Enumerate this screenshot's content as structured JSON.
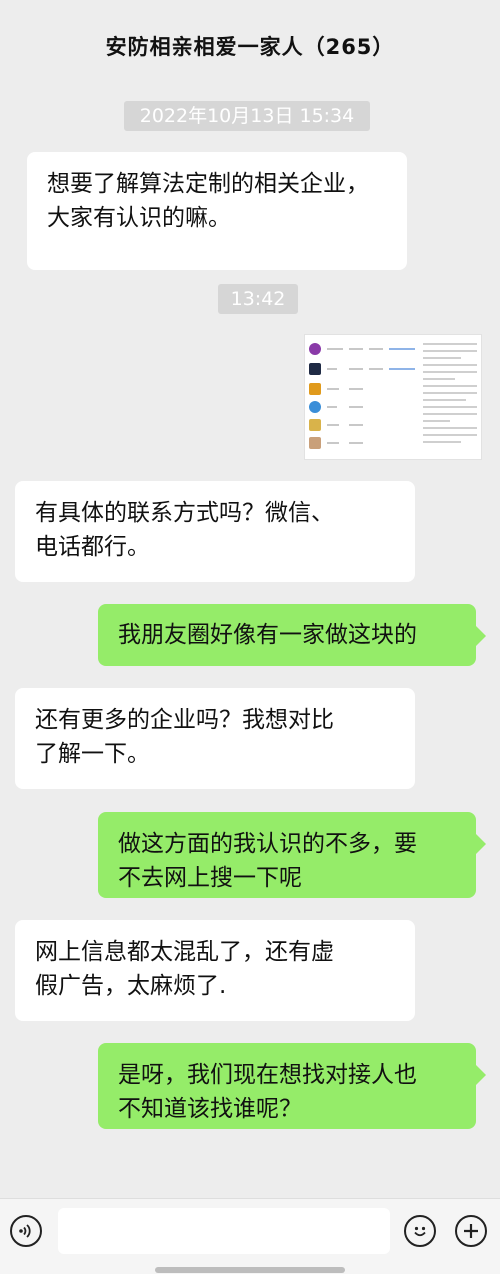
{
  "header": {
    "title": "安防相亲相爱一家人（265）"
  },
  "timestamps": [
    "2022年10月13日 15:34",
    "13:42"
  ],
  "messages": [
    {
      "side": "in",
      "text": "想要了解算法定制的相关企业，\n大家有认识的嘛。"
    },
    {
      "side": "out",
      "type": "image",
      "description_icon": "screenshot-thumbnail"
    },
    {
      "side": "in",
      "text": "有具体的联系方式吗？微信、\n电话都行。"
    },
    {
      "side": "out",
      "text": "我朋友圈好像有一家做这块的"
    },
    {
      "side": "in",
      "text": "还有更多的企业吗？我想对比\n了解一下。"
    },
    {
      "side": "out",
      "text": "做这方面的我认识的不多，要\n不去网上搜一下呢"
    },
    {
      "side": "in",
      "text": "网上信息都太混乱了，还有虚\n假广告，太麻烦了."
    },
    {
      "side": "out",
      "text": "是呀，我们现在想找对接人也\n不知道该找谁呢？"
    }
  ],
  "input_bar": {
    "voice_icon": "voice-icon",
    "emoji_icon": "emoji-icon",
    "plus_icon": "plus-icon",
    "placeholder": ""
  },
  "colors": {
    "background": "#ededed",
    "incoming_bubble": "#ffffff",
    "outgoing_bubble": "#95ec69",
    "timestamp_pill": "#d6d6d6"
  }
}
